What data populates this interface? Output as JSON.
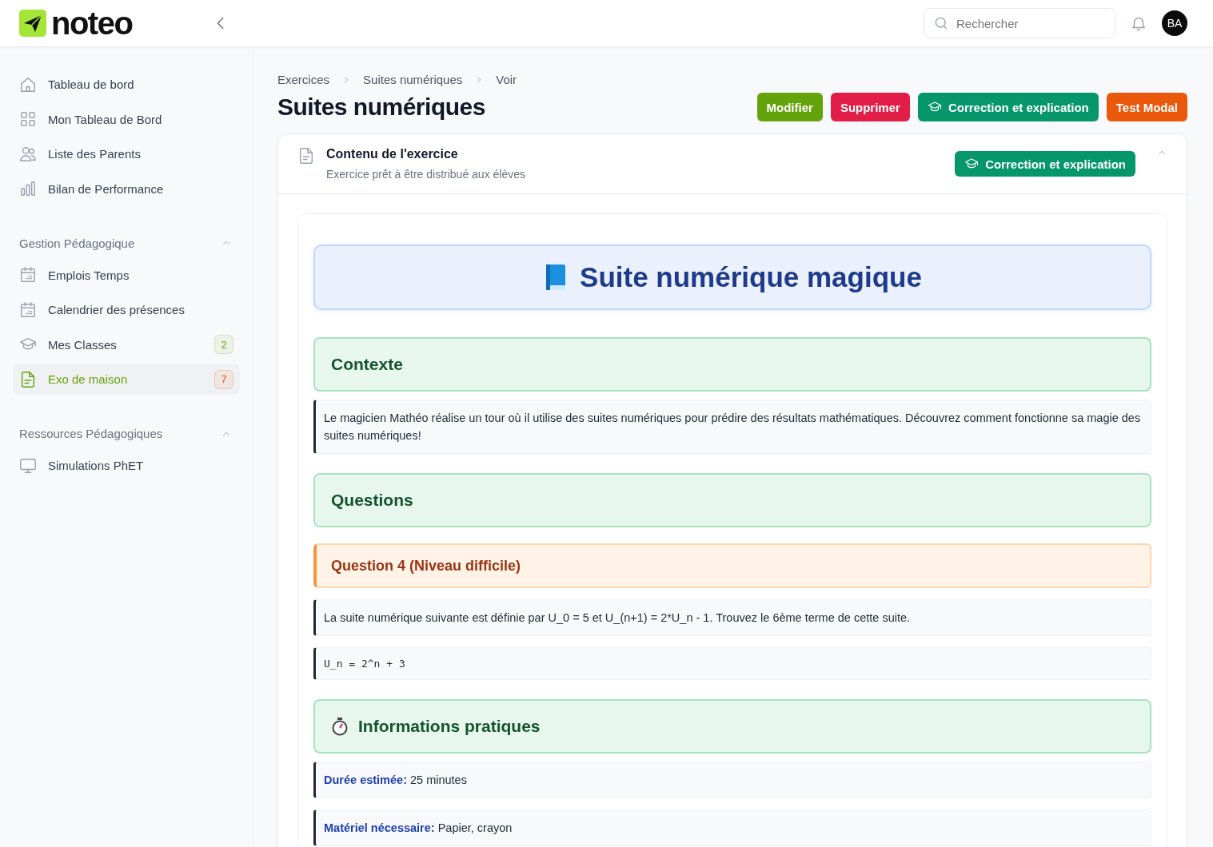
{
  "header": {
    "logo": "noteo",
    "search": {
      "placeholder": "Rechercher"
    },
    "avatar": "BA"
  },
  "sidebar": {
    "items": [
      {
        "label": "Tableau de bord",
        "selected": false
      },
      {
        "label": "Mon Tableau de Bord",
        "selected": false
      },
      {
        "label": "Liste des Parents",
        "selected": false
      },
      {
        "label": "Bilan de Performance",
        "selected": false
      }
    ],
    "sections": [
      {
        "title": "Gestion Pédagogique",
        "expanded": true,
        "items": [
          {
            "label": "Emplois Temps",
            "selected": false
          },
          {
            "label": "Calendrier des présences",
            "selected": false
          },
          {
            "label": "Mes Classes",
            "selected": false,
            "badge": "2",
            "color": "#65a30d"
          },
          {
            "label": "Exo de maison",
            "selected": true,
            "badge": "7",
            "color": "#ea580c"
          }
        ]
      },
      {
        "title": "Ressources Pédagogiques",
        "expanded": true,
        "items": [
          {
            "label": "Simulations PhET",
            "selected": false
          }
        ]
      }
    ]
  },
  "breadcrumb": [
    "Exercices",
    "Suites numériques",
    "Voir"
  ],
  "title": "Suites numériques",
  "actions": [
    {
      "label": "Modifier",
      "color": "#65a30d"
    },
    {
      "label": "Supprimer",
      "color": "#e11d48"
    },
    {
      "label": "Correction et explication",
      "color": "#059669",
      "kind": "cap"
    },
    {
      "label": "Test Modal",
      "color": "#ea580c"
    }
  ],
  "content": {
    "title": "Contenu de l'exercice",
    "subtitle": "Exercice prêt à être distribué aux élèves",
    "button": "Correction et explication",
    "expanded": true,
    "blocks": [
      {
        "kind": "title",
        "text": "Suite numérique magique"
      },
      {
        "kind": "section",
        "text": "Contexte"
      },
      {
        "kind": "text",
        "text": "Le magicien Mathéo réalise un tour où il utilise des suites numériques pour prédire des résultats mathématiques. Découvrez comment fonctionne sa magie des suites numériques!"
      },
      {
        "kind": "section",
        "text": "Questions"
      },
      {
        "kind": "question",
        "text": "Question 4 (Niveau difficile)"
      },
      {
        "kind": "text",
        "text": "La suite numérique suivante est définie par U_0 = 5 et U_(n+1) = 2*U_n - 1. Trouvez le 6ème terme de cette suite."
      },
      {
        "kind": "code",
        "text": "U_n = 2^n + 3"
      },
      {
        "kind": "timer",
        "text": "Informations pratiques"
      },
      {
        "kind": "info",
        "text": "**Durée estimée:** 25 minutes"
      },
      {
        "kind": "info",
        "text": "**Matériel nécessaire:** Papier, crayon"
      }
    ]
  }
}
